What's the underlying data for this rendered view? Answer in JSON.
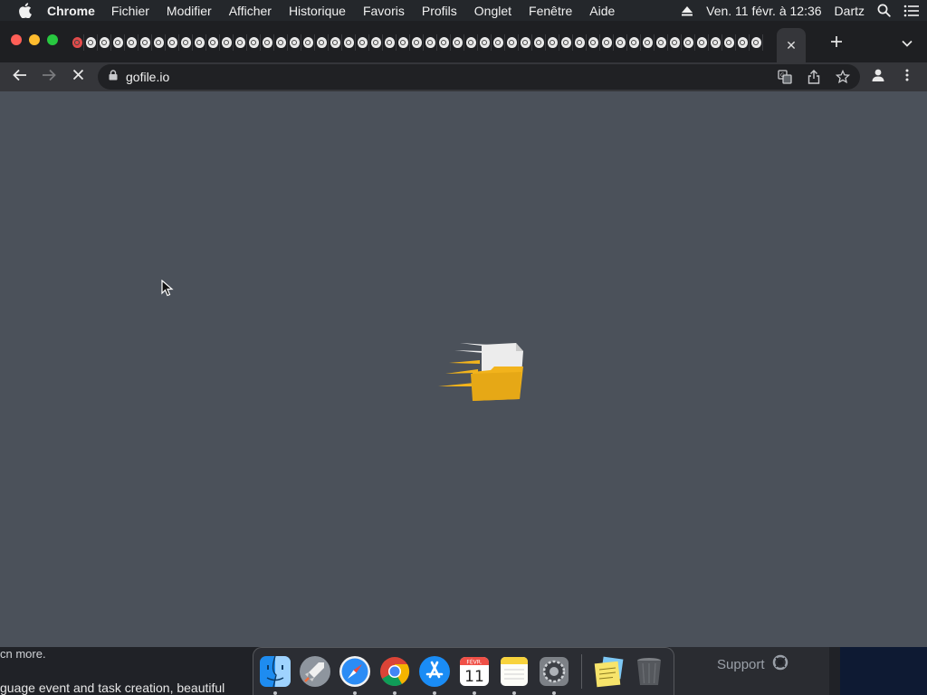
{
  "menubar": {
    "app_name": "Chrome",
    "items": [
      "Fichier",
      "Modifier",
      "Afficher",
      "Historique",
      "Favoris",
      "Profils",
      "Onglet",
      "Fenêtre",
      "Aide"
    ],
    "datetime": "Ven. 11 févr. à 12:36",
    "user": "Dartz"
  },
  "browser": {
    "tab_count_visible": 51,
    "active_tab_close": "✕",
    "new_tab": "+",
    "url": "gofile.io"
  },
  "page": {
    "state": "loading",
    "logo_icon": "gofile-folder-icon",
    "accent": "#f2b31c",
    "background": "#4b515a"
  },
  "background_window": {
    "line1": "cn more.",
    "line2": "guage event and task creation, beautiful",
    "support_label": "Support"
  },
  "dock": {
    "items": [
      {
        "name": "finder",
        "running": true
      },
      {
        "name": "launchpad",
        "running": false
      },
      {
        "name": "safari",
        "running": true
      },
      {
        "name": "chrome",
        "running": true
      },
      {
        "name": "app-store",
        "running": true
      },
      {
        "name": "calendar",
        "running": true,
        "month": "FÉVR.",
        "day": "11"
      },
      {
        "name": "notes",
        "running": true
      },
      {
        "name": "system-preferences",
        "running": true
      },
      {
        "name": "stickies",
        "running": false
      },
      {
        "name": "trash",
        "running": false
      }
    ]
  }
}
